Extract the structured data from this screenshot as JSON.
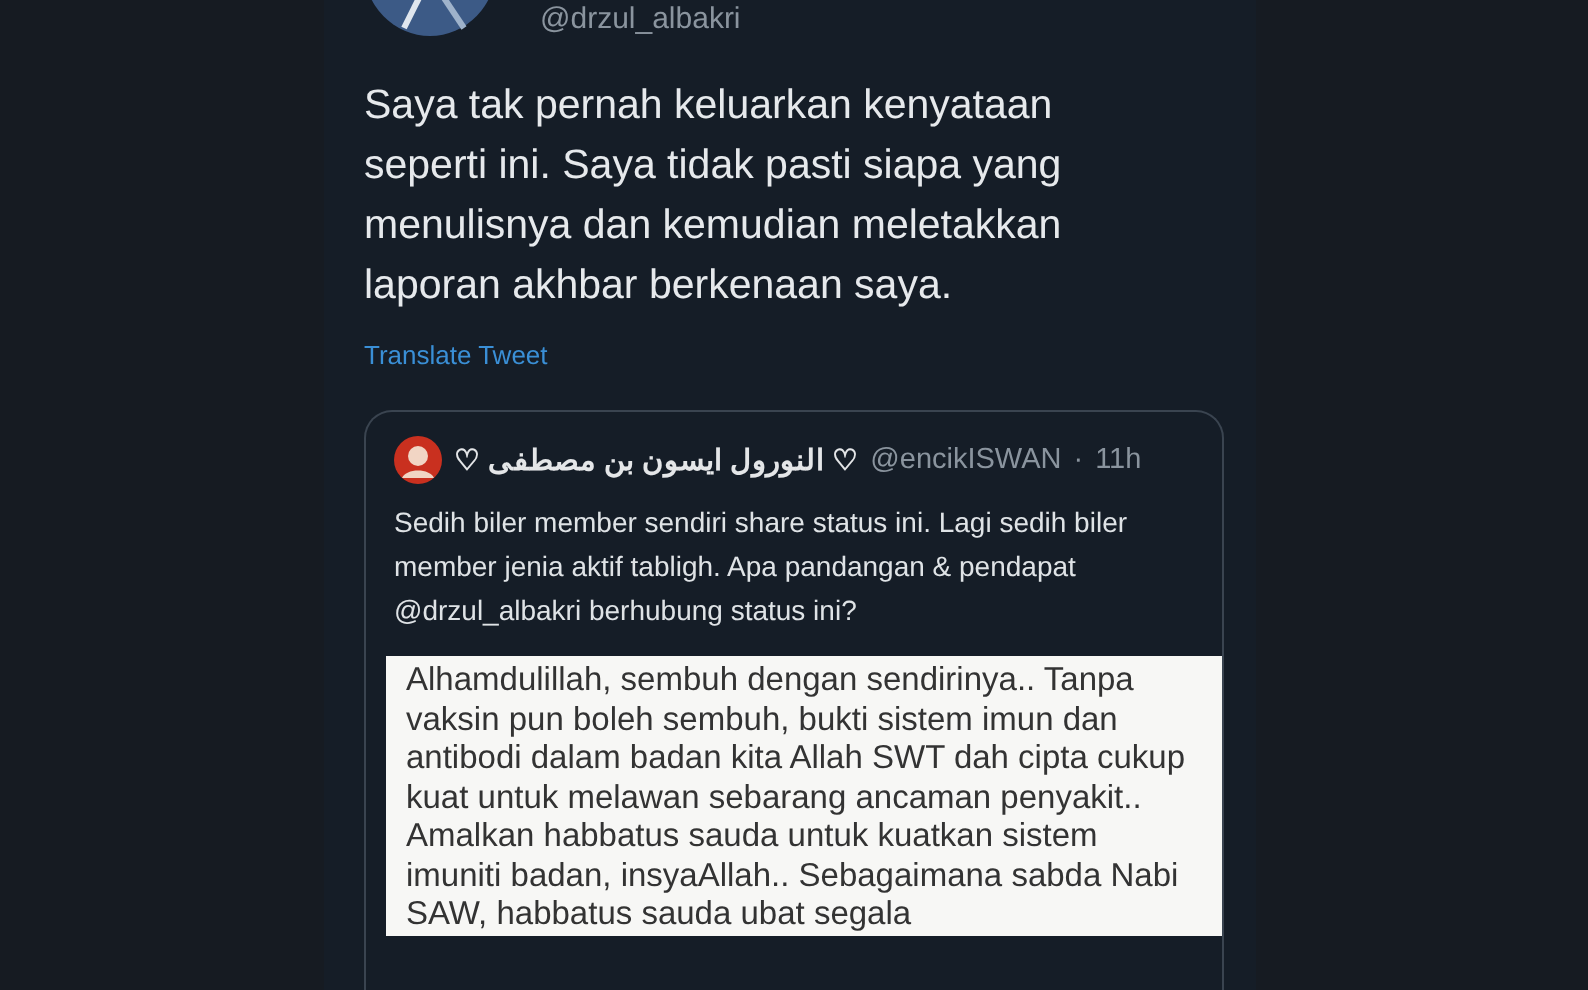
{
  "tweet": {
    "handle": "@drzul_albakri",
    "text": "Saya tak pernah keluarkan kenyataan seperti ini. Saya tidak pasti siapa yang menulisnya dan kemudian meletakkan laporan akhbar berkenaan saya.",
    "translate": "Translate Tweet"
  },
  "quoted": {
    "name": "♡ النورول ايسون بن مصطفى ♡",
    "handle": "@encikISWAN",
    "separator": "·",
    "time": "11h",
    "text": "Sedih biler member sendiri share status ini. Lagi sedih biler member jenia aktif tabligh. Apa pandangan & pendapat @drzul_albakri berhubung status ini?",
    "screenshot_text": "Alhamdulillah, sembuh dengan sendirinya.. Tanpa vaksin pun boleh sembuh, bukti sistem imun dan antibodi dalam badan kita Allah SWT dah cipta cukup kuat untuk melawan sebarang ancaman penyakit.. Amalkan habbatus sauda untuk kuatkan sistem imuniti badan, insyaAllah.. Sebagaimana sabda Nabi SAW, habbatus sauda ubat segala"
  }
}
